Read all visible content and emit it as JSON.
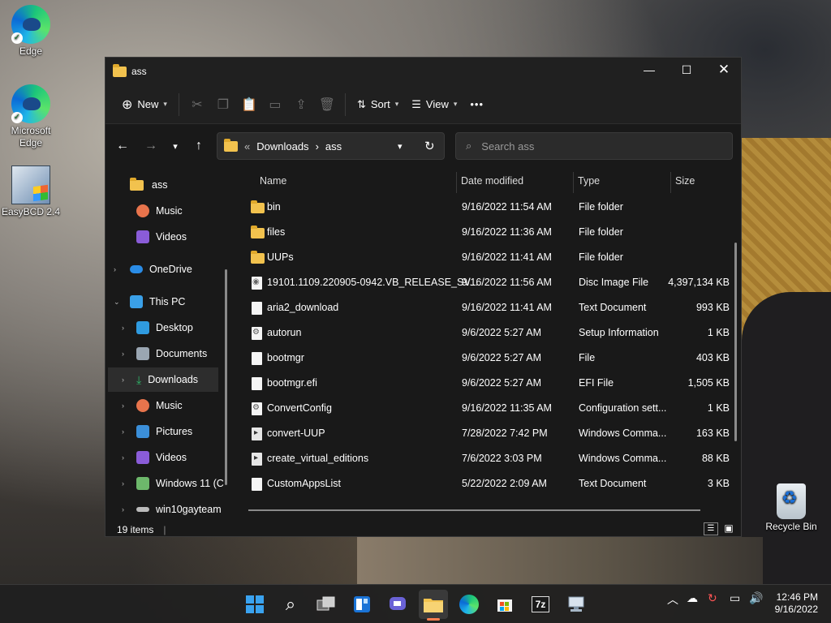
{
  "desktop": {
    "icons": [
      {
        "label": "Edge",
        "icon": "edge-icon"
      },
      {
        "label": "Microsoft Edge",
        "icon": "edge-icon"
      },
      {
        "label": "EasyBCD 2.4",
        "icon": "easybcd-icon"
      },
      {
        "label": "Recycle Bin",
        "icon": "recycle-bin-icon"
      }
    ]
  },
  "window": {
    "title": "ass",
    "toolbar": {
      "new_label": "New",
      "sort_label": "Sort",
      "view_label": "View",
      "more_label": "•••"
    },
    "address": {
      "prefix": "«",
      "crumb1": "Downloads",
      "sep": "›",
      "crumb2": "ass"
    },
    "search": {
      "placeholder": "Search ass"
    },
    "sidebar": {
      "items": [
        {
          "label": "ass",
          "icon": "folder-icon"
        },
        {
          "label": "Music",
          "icon": "music-icon"
        },
        {
          "label": "Videos",
          "icon": "videos-icon"
        },
        {
          "label": "OneDrive",
          "icon": "onedrive-icon"
        },
        {
          "label": "This PC",
          "icon": "pc-icon"
        },
        {
          "label": "Desktop",
          "icon": "desktop-icon"
        },
        {
          "label": "Documents",
          "icon": "documents-icon"
        },
        {
          "label": "Downloads",
          "icon": "downloads-icon"
        },
        {
          "label": "Music",
          "icon": "music-icon"
        },
        {
          "label": "Pictures",
          "icon": "pictures-icon"
        },
        {
          "label": "Videos",
          "icon": "videos-icon"
        },
        {
          "label": "Windows 11 (C",
          "icon": "drive-icon"
        },
        {
          "label": "win10gayteam",
          "icon": "drive-icon"
        }
      ]
    },
    "columns": {
      "name": "Name",
      "date": "Date modified",
      "type": "Type",
      "size": "Size"
    },
    "files": [
      {
        "name": "bin",
        "date": "9/16/2022 11:54 AM",
        "type": "File folder",
        "size": "",
        "icon": "folder"
      },
      {
        "name": "files",
        "date": "9/16/2022 11:36 AM",
        "type": "File folder",
        "size": "",
        "icon": "folder"
      },
      {
        "name": "UUPs",
        "date": "9/16/2022 11:41 AM",
        "type": "File folder",
        "size": "",
        "icon": "folder"
      },
      {
        "name": "19101.1109.220905-0942.VB_RELEASE_SV...",
        "date": "9/16/2022 11:56 AM",
        "type": "Disc Image File",
        "size": "4,397,134 KB",
        "icon": "disc"
      },
      {
        "name": "aria2_download",
        "date": "9/16/2022 11:41 AM",
        "type": "Text Document",
        "size": "993 KB",
        "icon": "file"
      },
      {
        "name": "autorun",
        "date": "9/6/2022 5:27 AM",
        "type": "Setup Information",
        "size": "1 KB",
        "icon": "gear"
      },
      {
        "name": "bootmgr",
        "date": "9/6/2022 5:27 AM",
        "type": "File",
        "size": "403 KB",
        "icon": "file"
      },
      {
        "name": "bootmgr.efi",
        "date": "9/6/2022 5:27 AM",
        "type": "EFI File",
        "size": "1,505 KB",
        "icon": "file"
      },
      {
        "name": "ConvertConfig",
        "date": "9/16/2022 11:35 AM",
        "type": "Configuration sett...",
        "size": "1 KB",
        "icon": "gear"
      },
      {
        "name": "convert-UUP",
        "date": "7/28/2022 7:42 PM",
        "type": "Windows Comma...",
        "size": "163 KB",
        "icon": "cmd"
      },
      {
        "name": "create_virtual_editions",
        "date": "7/6/2022 3:03 PM",
        "type": "Windows Comma...",
        "size": "88 KB",
        "icon": "cmd"
      },
      {
        "name": "CustomAppsList",
        "date": "5/22/2022 2:09 AM",
        "type": "Text Document",
        "size": "3 KB",
        "icon": "file"
      }
    ],
    "status": {
      "count": "19 items"
    }
  },
  "taskbar": {
    "apps": [
      "start-icon",
      "search-icon",
      "task-view-icon",
      "widgets-icon",
      "teams-chat-icon",
      "file-explorer-icon",
      "edge-icon",
      "store-icon",
      "7zip-icon",
      "remote-icon"
    ],
    "seven_zip_label": "7z",
    "clock": {
      "time": "12:46 PM",
      "date": "9/16/2022"
    }
  },
  "colors": {
    "accent": "#4aa3f0",
    "folder": "#f2c24e",
    "window_bg": "#191919"
  }
}
